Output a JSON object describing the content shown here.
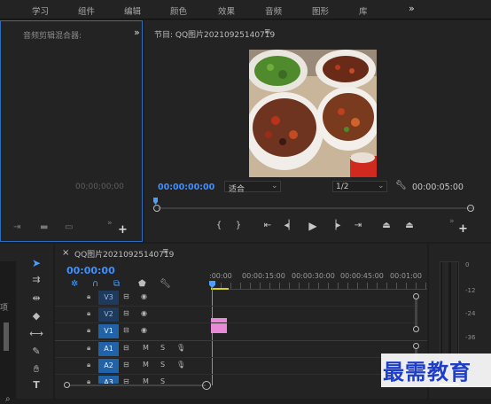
{
  "workspaces": [
    "学习",
    "组件",
    "编辑",
    "颜色",
    "效果",
    "音频",
    "图形",
    "库"
  ],
  "workspaces_more": "»",
  "audio_mixer": {
    "title": "音频剪辑混合器:",
    "more": "»",
    "timecode": "00;00;00;00"
  },
  "program": {
    "title": "节目: QQ图片20210925140719",
    "menu": "≡",
    "timecode_current": "00:00:00:00",
    "fit": "适合",
    "resolution": "1/2",
    "timecode_duration": "00:00:05:00"
  },
  "timeline": {
    "close": "×",
    "sequence": "QQ图片20210925140719",
    "menu": "≡",
    "timecode": "00:00:00",
    "ruler": [
      ":00:00",
      "00:00:15:00",
      "00:00:30:00",
      "00:00:45:00",
      "00:01:00"
    ],
    "tracks": [
      {
        "id": "V3",
        "kind": "video"
      },
      {
        "id": "V2",
        "kind": "video"
      },
      {
        "id": "V1",
        "kind": "video"
      },
      {
        "id": "A1",
        "kind": "audio",
        "m": "M",
        "s": "S"
      },
      {
        "id": "A2",
        "kind": "audio",
        "m": "M",
        "s": "S"
      },
      {
        "id": "A3",
        "kind": "audio",
        "m": "M",
        "s": "S"
      }
    ],
    "clip_color": "#e88ad6"
  },
  "side_label": "项",
  "meters": {
    "labels": [
      "0",
      "-12",
      "-24",
      "-36"
    ]
  },
  "watermark": "最需教育",
  "colors": {
    "accent": "#3f8fff",
    "playhead": "#4a9eff",
    "clip": "#e88ad6",
    "watermark": "#1f3ec8"
  },
  "icons": {
    "play": "play-icon",
    "lock": "lock-icon",
    "eye": "eye-icon",
    "wrench": "wrench-icon"
  }
}
